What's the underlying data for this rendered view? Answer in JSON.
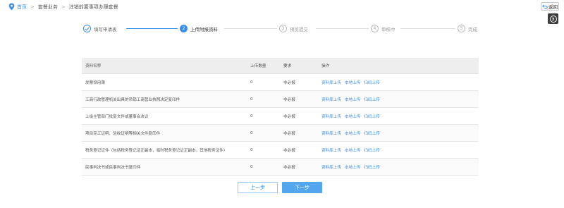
{
  "breadcrumb": {
    "items": [
      "首页",
      "套餐业务",
      "注销前置事项办理套餐"
    ],
    "separator": ">"
  },
  "back_button": {
    "label": "返回"
  },
  "help_button": {
    "label": "?"
  },
  "steps": [
    {
      "number": "1",
      "label": "填写申请表",
      "status": "done"
    },
    {
      "number": "2",
      "label": "上传附报资料",
      "status": "active"
    },
    {
      "number": "3",
      "label": "预览提交",
      "status": "pending"
    },
    {
      "number": "4",
      "label": "审核中",
      "status": "pending"
    },
    {
      "number": "5",
      "label": "完成",
      "status": "pending"
    }
  ],
  "table": {
    "headers": [
      "资料名称",
      "上传数量",
      "要求",
      "操作"
    ],
    "action_labels": [
      "资料库上传",
      "本地上传",
      "扫码上传"
    ],
    "rows": [
      {
        "name": "发票领用簿",
        "count": "0",
        "requirement": "非必报"
      },
      {
        "name": "工商行政管理机关出具的吊销工商营业执照决定复印件",
        "count": "0",
        "requirement": "非必报"
      },
      {
        "name": "上级主管部门批复文件或董事会决议",
        "count": "0",
        "requirement": "非必报"
      },
      {
        "name": "项目完工证明、验收证明等相关文件复印件",
        "count": "0",
        "requirement": "非必报"
      },
      {
        "name": "税务登记证件（包括税务登记证正副本，临时税务登记证正副本，其他税务证件）",
        "count": "0",
        "requirement": "非必报"
      },
      {
        "name": "民事判决书或民事判决书复印件",
        "count": "0",
        "requirement": "非必报"
      }
    ]
  },
  "buttons": {
    "prev": "上一步",
    "next": "下一步"
  },
  "colors": {
    "accent": "#3a8ee6",
    "header_bg": "#eeeeee"
  }
}
